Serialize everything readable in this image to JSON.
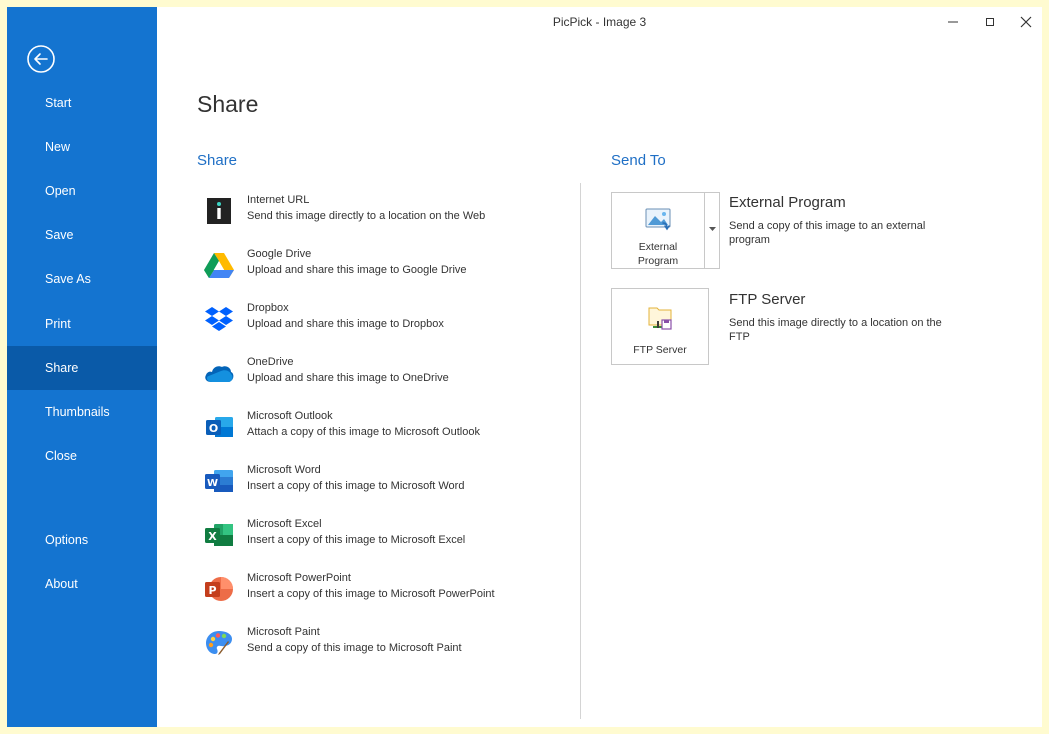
{
  "window": {
    "title": "PicPick - Image 3"
  },
  "sidebar": {
    "items": [
      {
        "label": "Start"
      },
      {
        "label": "New"
      },
      {
        "label": "Open"
      },
      {
        "label": "Save"
      },
      {
        "label": "Save As"
      },
      {
        "label": "Print"
      },
      {
        "label": "Share",
        "active": true
      },
      {
        "label": "Thumbnails"
      },
      {
        "label": "Close"
      },
      {
        "label": "Options"
      },
      {
        "label": "About"
      }
    ]
  },
  "main": {
    "title": "Share",
    "share_heading": "Share",
    "sendto_heading": "Send To",
    "share_items": [
      {
        "name": "Internet URL",
        "desc": "Send this image directly to a location on the Web",
        "icon": "internet-url-icon"
      },
      {
        "name": "Google Drive",
        "desc": "Upload and share this image to Google Drive",
        "icon": "google-drive-icon"
      },
      {
        "name": "Dropbox",
        "desc": "Upload and share this image to Dropbox",
        "icon": "dropbox-icon"
      },
      {
        "name": "OneDrive",
        "desc": "Upload and share this image to OneDrive",
        "icon": "onedrive-icon"
      },
      {
        "name": "Microsoft Outlook",
        "desc": "Attach a copy of this image to Microsoft Outlook",
        "icon": "outlook-icon"
      },
      {
        "name": "Microsoft Word",
        "desc": "Insert a copy of this image to Microsoft Word",
        "icon": "word-icon"
      },
      {
        "name": "Microsoft Excel",
        "desc": "Insert a copy of this image to Microsoft Excel",
        "icon": "excel-icon"
      },
      {
        "name": "Microsoft PowerPoint",
        "desc": "Insert a copy of this image to Microsoft PowerPoint",
        "icon": "powerpoint-icon"
      },
      {
        "name": "Microsoft Paint",
        "desc": "Send a copy of this image to Microsoft Paint",
        "icon": "paint-icon"
      }
    ],
    "sendto": {
      "external": {
        "button_line1": "External",
        "button_line2": "Program",
        "title": "External Program",
        "desc": "Send a copy of this image to an external program"
      },
      "ftp": {
        "button_label": "FTP Server",
        "title": "FTP Server",
        "desc": "Send this image directly to a location on the FTP"
      }
    }
  },
  "colors": {
    "sidebar": "#1474d0",
    "sidebar_active": "#0a5aa8",
    "heading_blue": "#1f6fc5",
    "frame": "#fffbd0"
  }
}
